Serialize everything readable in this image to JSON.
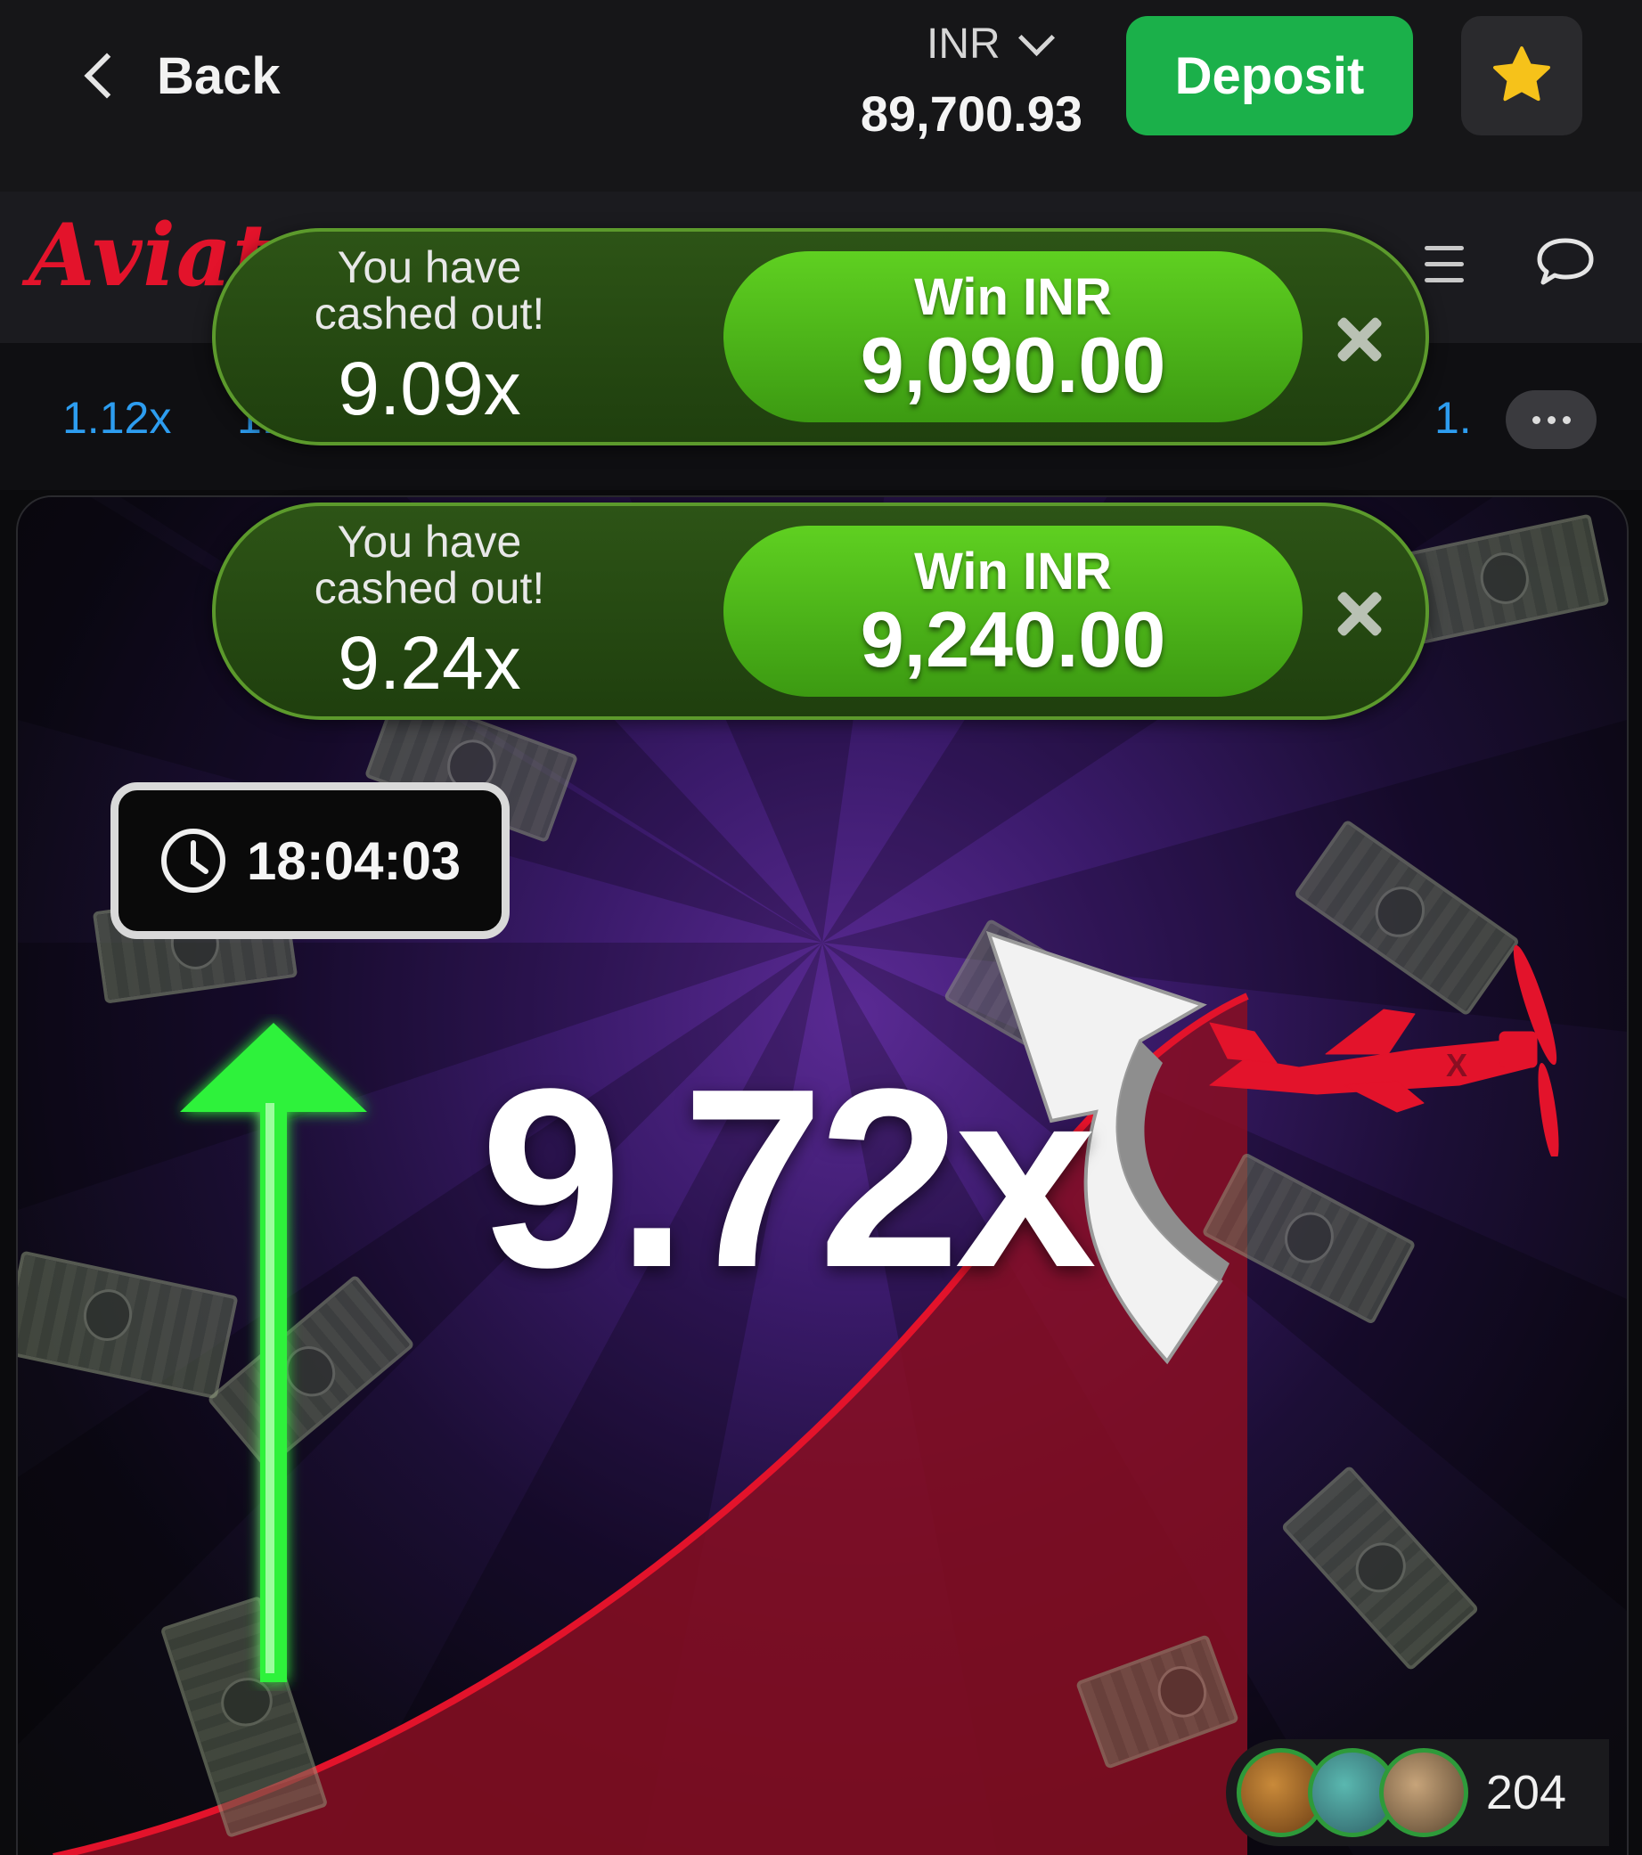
{
  "topbar": {
    "back_label": "Back",
    "currency": "INR",
    "balance": "89,700.93",
    "deposit_label": "Deposit",
    "favorite_icon": "star-icon"
  },
  "game": {
    "logo_text": "Aviator",
    "history": [
      "1.12x",
      "1.",
      "1."
    ],
    "multiplier": "9.72x",
    "timer": "18:04:03",
    "players_count": "204"
  },
  "toasts": [
    {
      "message": "You have cashed out!",
      "multiplier": "9.09x",
      "win_label": "Win INR",
      "win_amount": "9,090.00"
    },
    {
      "message": "You have cashed out!",
      "multiplier": "9.24x",
      "win_label": "Win INR",
      "win_amount": "9,240.00"
    }
  ],
  "colors": {
    "deposit_green": "#1bb04a",
    "logo_red": "#e3132b",
    "curve_red": "#e3132b",
    "history_blue": "#2d9df0",
    "toast_green": "#3c9a12"
  }
}
